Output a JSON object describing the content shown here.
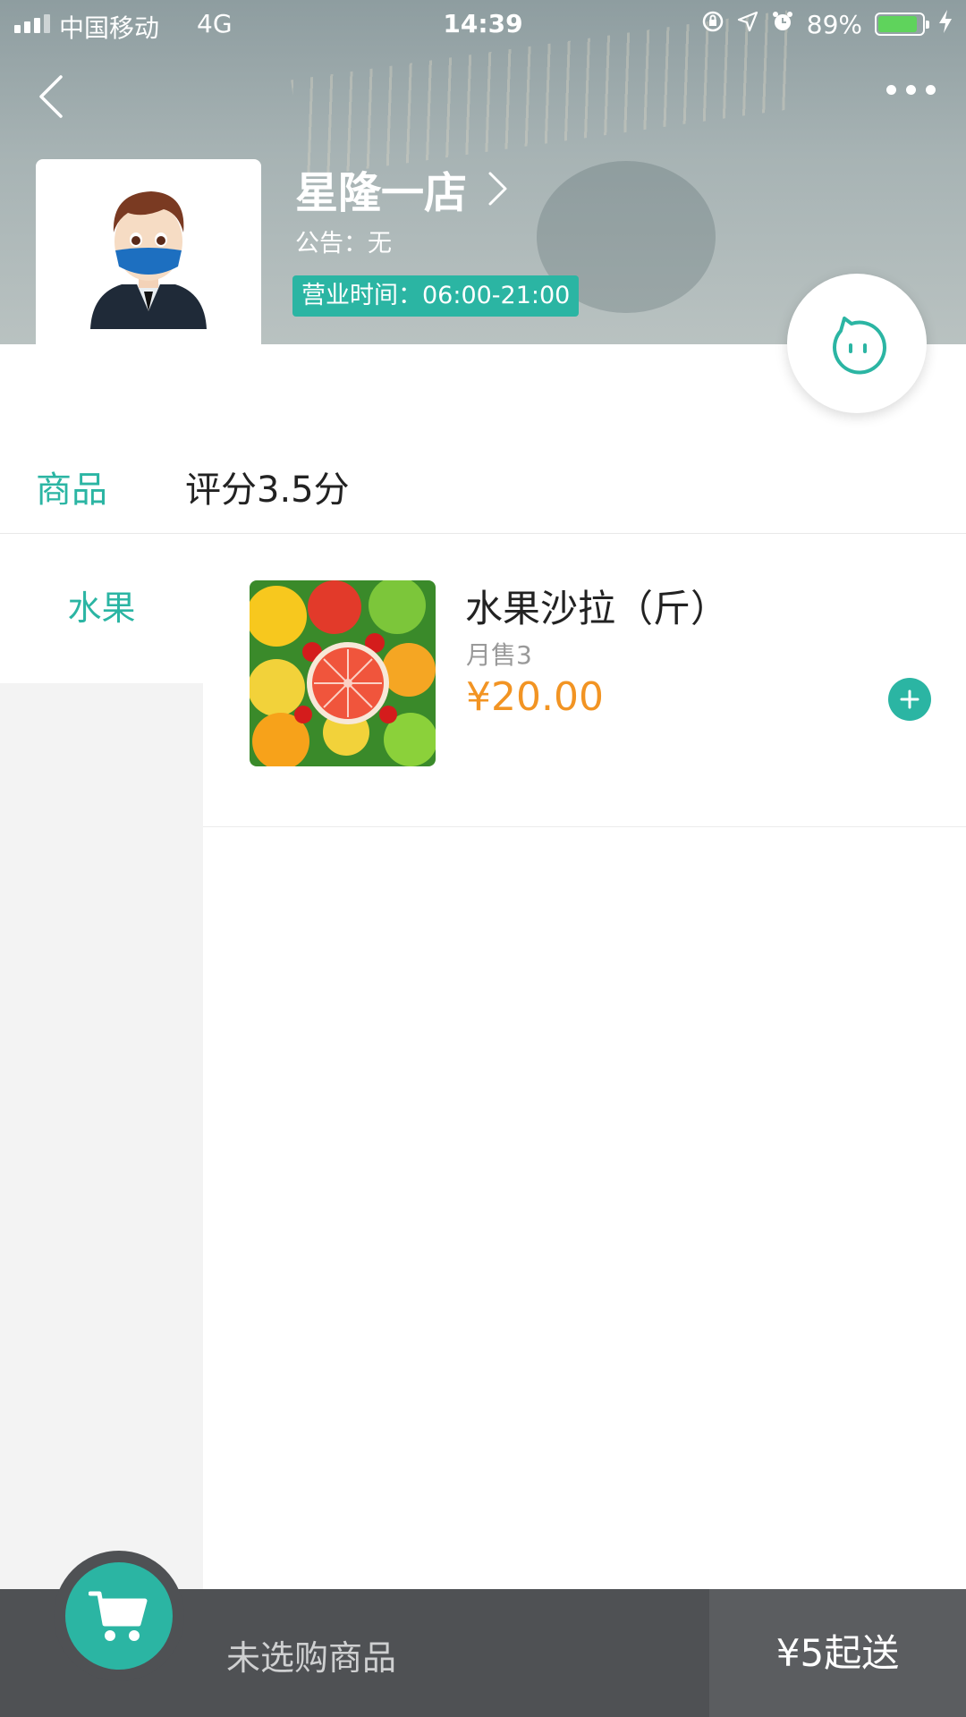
{
  "status_bar": {
    "carrier": "中国移动",
    "network": "4G",
    "time": "14:39",
    "battery_percent_text": "89%",
    "battery_level": 0.89,
    "icons": [
      "rotation-lock-icon",
      "location-icon",
      "alarm-icon",
      "charging-icon"
    ]
  },
  "header": {
    "back_icon": "chevron-left-icon",
    "more_icon": "more-dots-icon",
    "shop_name": "星隆一店",
    "notice": "公告：无",
    "business_hours": "营业时间：06:00-21:00",
    "chat_icon": "chat-face-icon"
  },
  "tabs": [
    {
      "label": "商品",
      "active": true
    },
    {
      "label": "评分3.5分",
      "active": false
    }
  ],
  "categories": [
    {
      "label": "水果",
      "active": true
    }
  ],
  "products": [
    {
      "name": "水果沙拉（斤）",
      "sales": "月售3",
      "price": "¥20.00",
      "image_icon": "fruit-image"
    }
  ],
  "cart": {
    "status": "未选购商品",
    "checkout_label": "¥5起送",
    "cart_icon": "shopping-cart-icon"
  },
  "colors": {
    "accent": "#2bb5a3",
    "price": "#f29423",
    "cart_bar": "#4f5154"
  }
}
